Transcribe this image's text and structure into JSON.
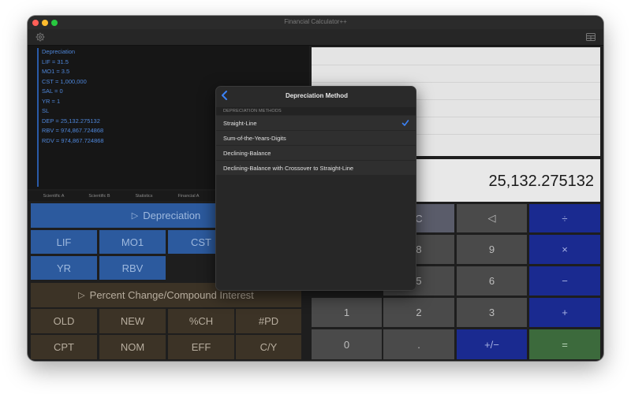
{
  "window": {
    "title": "Financial Calculator++"
  },
  "tape": {
    "lines": [
      "Depreciation",
      "LIF = 31.5",
      "MO1 = 3.5",
      "CST = 1,000,000",
      "SAL = 0",
      "YR = 1",
      "SL",
      "DEP = 25,132.275132",
      "RBV = 974,867.724868",
      "RDV = 974,867.724868"
    ]
  },
  "tabs": [
    "Scientific A",
    "Scientific B",
    "Statistics",
    "Financial A"
  ],
  "depreciation_panel": {
    "header": "Depreciation",
    "keys_row1": [
      "LIF",
      "MO1",
      "CST"
    ],
    "keys_row2": [
      "YR",
      "RBV"
    ]
  },
  "percent_panel": {
    "header": "Percent Change/Compound Interest",
    "keys_row1": [
      "OLD",
      "NEW",
      "%CH",
      "#PD"
    ],
    "keys_row2": [
      "CPT",
      "NOM",
      "EFF",
      "C/Y"
    ]
  },
  "display": {
    "value": "25,132.275132"
  },
  "keypad": {
    "row1": [
      "C",
      "◁",
      "÷"
    ],
    "row2": [
      "8",
      "9",
      "×"
    ],
    "row3": [
      "5",
      "6",
      "−"
    ],
    "row4": [
      "1",
      "2",
      "3",
      "+"
    ],
    "row5": [
      "0",
      ".",
      "+/−",
      "="
    ]
  },
  "popover": {
    "title": "Depreciation Method",
    "section": "DEPRECIATION METHODS",
    "items": [
      "Straight-Line",
      "Sum-of-the-Years-Digits",
      "Declining-Balance",
      "Declining-Balance with Crossover to Straight-Line"
    ],
    "selected_index": 0
  },
  "colors": {
    "accent": "#3b82f6",
    "blue_key": "#2c5a9e",
    "brown_key": "#3c3326",
    "navy_key": "#1a2a90",
    "green_key": "#3c6a3c"
  }
}
